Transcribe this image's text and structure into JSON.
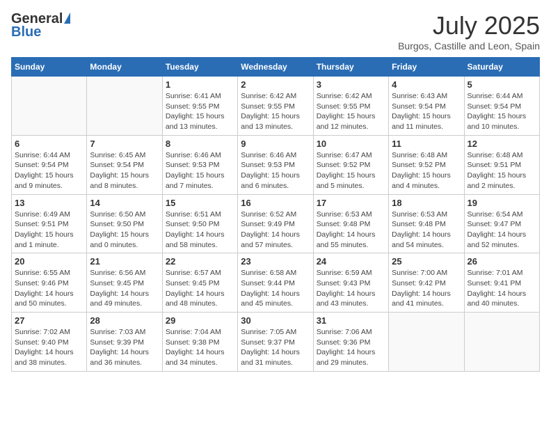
{
  "header": {
    "logo_general": "General",
    "logo_blue": "Blue",
    "month": "July 2025",
    "location": "Burgos, Castille and Leon, Spain"
  },
  "weekdays": [
    "Sunday",
    "Monday",
    "Tuesday",
    "Wednesday",
    "Thursday",
    "Friday",
    "Saturday"
  ],
  "weeks": [
    [
      {
        "day": "",
        "sunrise": "",
        "sunset": "",
        "daylight": ""
      },
      {
        "day": "",
        "sunrise": "",
        "sunset": "",
        "daylight": ""
      },
      {
        "day": "1",
        "sunrise": "Sunrise: 6:41 AM",
        "sunset": "Sunset: 9:55 PM",
        "daylight": "Daylight: 15 hours and 13 minutes."
      },
      {
        "day": "2",
        "sunrise": "Sunrise: 6:42 AM",
        "sunset": "Sunset: 9:55 PM",
        "daylight": "Daylight: 15 hours and 13 minutes."
      },
      {
        "day": "3",
        "sunrise": "Sunrise: 6:42 AM",
        "sunset": "Sunset: 9:55 PM",
        "daylight": "Daylight: 15 hours and 12 minutes."
      },
      {
        "day": "4",
        "sunrise": "Sunrise: 6:43 AM",
        "sunset": "Sunset: 9:54 PM",
        "daylight": "Daylight: 15 hours and 11 minutes."
      },
      {
        "day": "5",
        "sunrise": "Sunrise: 6:44 AM",
        "sunset": "Sunset: 9:54 PM",
        "daylight": "Daylight: 15 hours and 10 minutes."
      }
    ],
    [
      {
        "day": "6",
        "sunrise": "Sunrise: 6:44 AM",
        "sunset": "Sunset: 9:54 PM",
        "daylight": "Daylight: 15 hours and 9 minutes."
      },
      {
        "day": "7",
        "sunrise": "Sunrise: 6:45 AM",
        "sunset": "Sunset: 9:54 PM",
        "daylight": "Daylight: 15 hours and 8 minutes."
      },
      {
        "day": "8",
        "sunrise": "Sunrise: 6:46 AM",
        "sunset": "Sunset: 9:53 PM",
        "daylight": "Daylight: 15 hours and 7 minutes."
      },
      {
        "day": "9",
        "sunrise": "Sunrise: 6:46 AM",
        "sunset": "Sunset: 9:53 PM",
        "daylight": "Daylight: 15 hours and 6 minutes."
      },
      {
        "day": "10",
        "sunrise": "Sunrise: 6:47 AM",
        "sunset": "Sunset: 9:52 PM",
        "daylight": "Daylight: 15 hours and 5 minutes."
      },
      {
        "day": "11",
        "sunrise": "Sunrise: 6:48 AM",
        "sunset": "Sunset: 9:52 PM",
        "daylight": "Daylight: 15 hours and 4 minutes."
      },
      {
        "day": "12",
        "sunrise": "Sunrise: 6:48 AM",
        "sunset": "Sunset: 9:51 PM",
        "daylight": "Daylight: 15 hours and 2 minutes."
      }
    ],
    [
      {
        "day": "13",
        "sunrise": "Sunrise: 6:49 AM",
        "sunset": "Sunset: 9:51 PM",
        "daylight": "Daylight: 15 hours and 1 minute."
      },
      {
        "day": "14",
        "sunrise": "Sunrise: 6:50 AM",
        "sunset": "Sunset: 9:50 PM",
        "daylight": "Daylight: 15 hours and 0 minutes."
      },
      {
        "day": "15",
        "sunrise": "Sunrise: 6:51 AM",
        "sunset": "Sunset: 9:50 PM",
        "daylight": "Daylight: 14 hours and 58 minutes."
      },
      {
        "day": "16",
        "sunrise": "Sunrise: 6:52 AM",
        "sunset": "Sunset: 9:49 PM",
        "daylight": "Daylight: 14 hours and 57 minutes."
      },
      {
        "day": "17",
        "sunrise": "Sunrise: 6:53 AM",
        "sunset": "Sunset: 9:48 PM",
        "daylight": "Daylight: 14 hours and 55 minutes."
      },
      {
        "day": "18",
        "sunrise": "Sunrise: 6:53 AM",
        "sunset": "Sunset: 9:48 PM",
        "daylight": "Daylight: 14 hours and 54 minutes."
      },
      {
        "day": "19",
        "sunrise": "Sunrise: 6:54 AM",
        "sunset": "Sunset: 9:47 PM",
        "daylight": "Daylight: 14 hours and 52 minutes."
      }
    ],
    [
      {
        "day": "20",
        "sunrise": "Sunrise: 6:55 AM",
        "sunset": "Sunset: 9:46 PM",
        "daylight": "Daylight: 14 hours and 50 minutes."
      },
      {
        "day": "21",
        "sunrise": "Sunrise: 6:56 AM",
        "sunset": "Sunset: 9:45 PM",
        "daylight": "Daylight: 14 hours and 49 minutes."
      },
      {
        "day": "22",
        "sunrise": "Sunrise: 6:57 AM",
        "sunset": "Sunset: 9:45 PM",
        "daylight": "Daylight: 14 hours and 48 minutes."
      },
      {
        "day": "23",
        "sunrise": "Sunrise: 6:58 AM",
        "sunset": "Sunset: 9:44 PM",
        "daylight": "Daylight: 14 hours and 45 minutes."
      },
      {
        "day": "24",
        "sunrise": "Sunrise: 6:59 AM",
        "sunset": "Sunset: 9:43 PM",
        "daylight": "Daylight: 14 hours and 43 minutes."
      },
      {
        "day": "25",
        "sunrise": "Sunrise: 7:00 AM",
        "sunset": "Sunset: 9:42 PM",
        "daylight": "Daylight: 14 hours and 41 minutes."
      },
      {
        "day": "26",
        "sunrise": "Sunrise: 7:01 AM",
        "sunset": "Sunset: 9:41 PM",
        "daylight": "Daylight: 14 hours and 40 minutes."
      }
    ],
    [
      {
        "day": "27",
        "sunrise": "Sunrise: 7:02 AM",
        "sunset": "Sunset: 9:40 PM",
        "daylight": "Daylight: 14 hours and 38 minutes."
      },
      {
        "day": "28",
        "sunrise": "Sunrise: 7:03 AM",
        "sunset": "Sunset: 9:39 PM",
        "daylight": "Daylight: 14 hours and 36 minutes."
      },
      {
        "day": "29",
        "sunrise": "Sunrise: 7:04 AM",
        "sunset": "Sunset: 9:38 PM",
        "daylight": "Daylight: 14 hours and 34 minutes."
      },
      {
        "day": "30",
        "sunrise": "Sunrise: 7:05 AM",
        "sunset": "Sunset: 9:37 PM",
        "daylight": "Daylight: 14 hours and 31 minutes."
      },
      {
        "day": "31",
        "sunrise": "Sunrise: 7:06 AM",
        "sunset": "Sunset: 9:36 PM",
        "daylight": "Daylight: 14 hours and 29 minutes."
      },
      {
        "day": "",
        "sunrise": "",
        "sunset": "",
        "daylight": ""
      },
      {
        "day": "",
        "sunrise": "",
        "sunset": "",
        "daylight": ""
      }
    ]
  ]
}
